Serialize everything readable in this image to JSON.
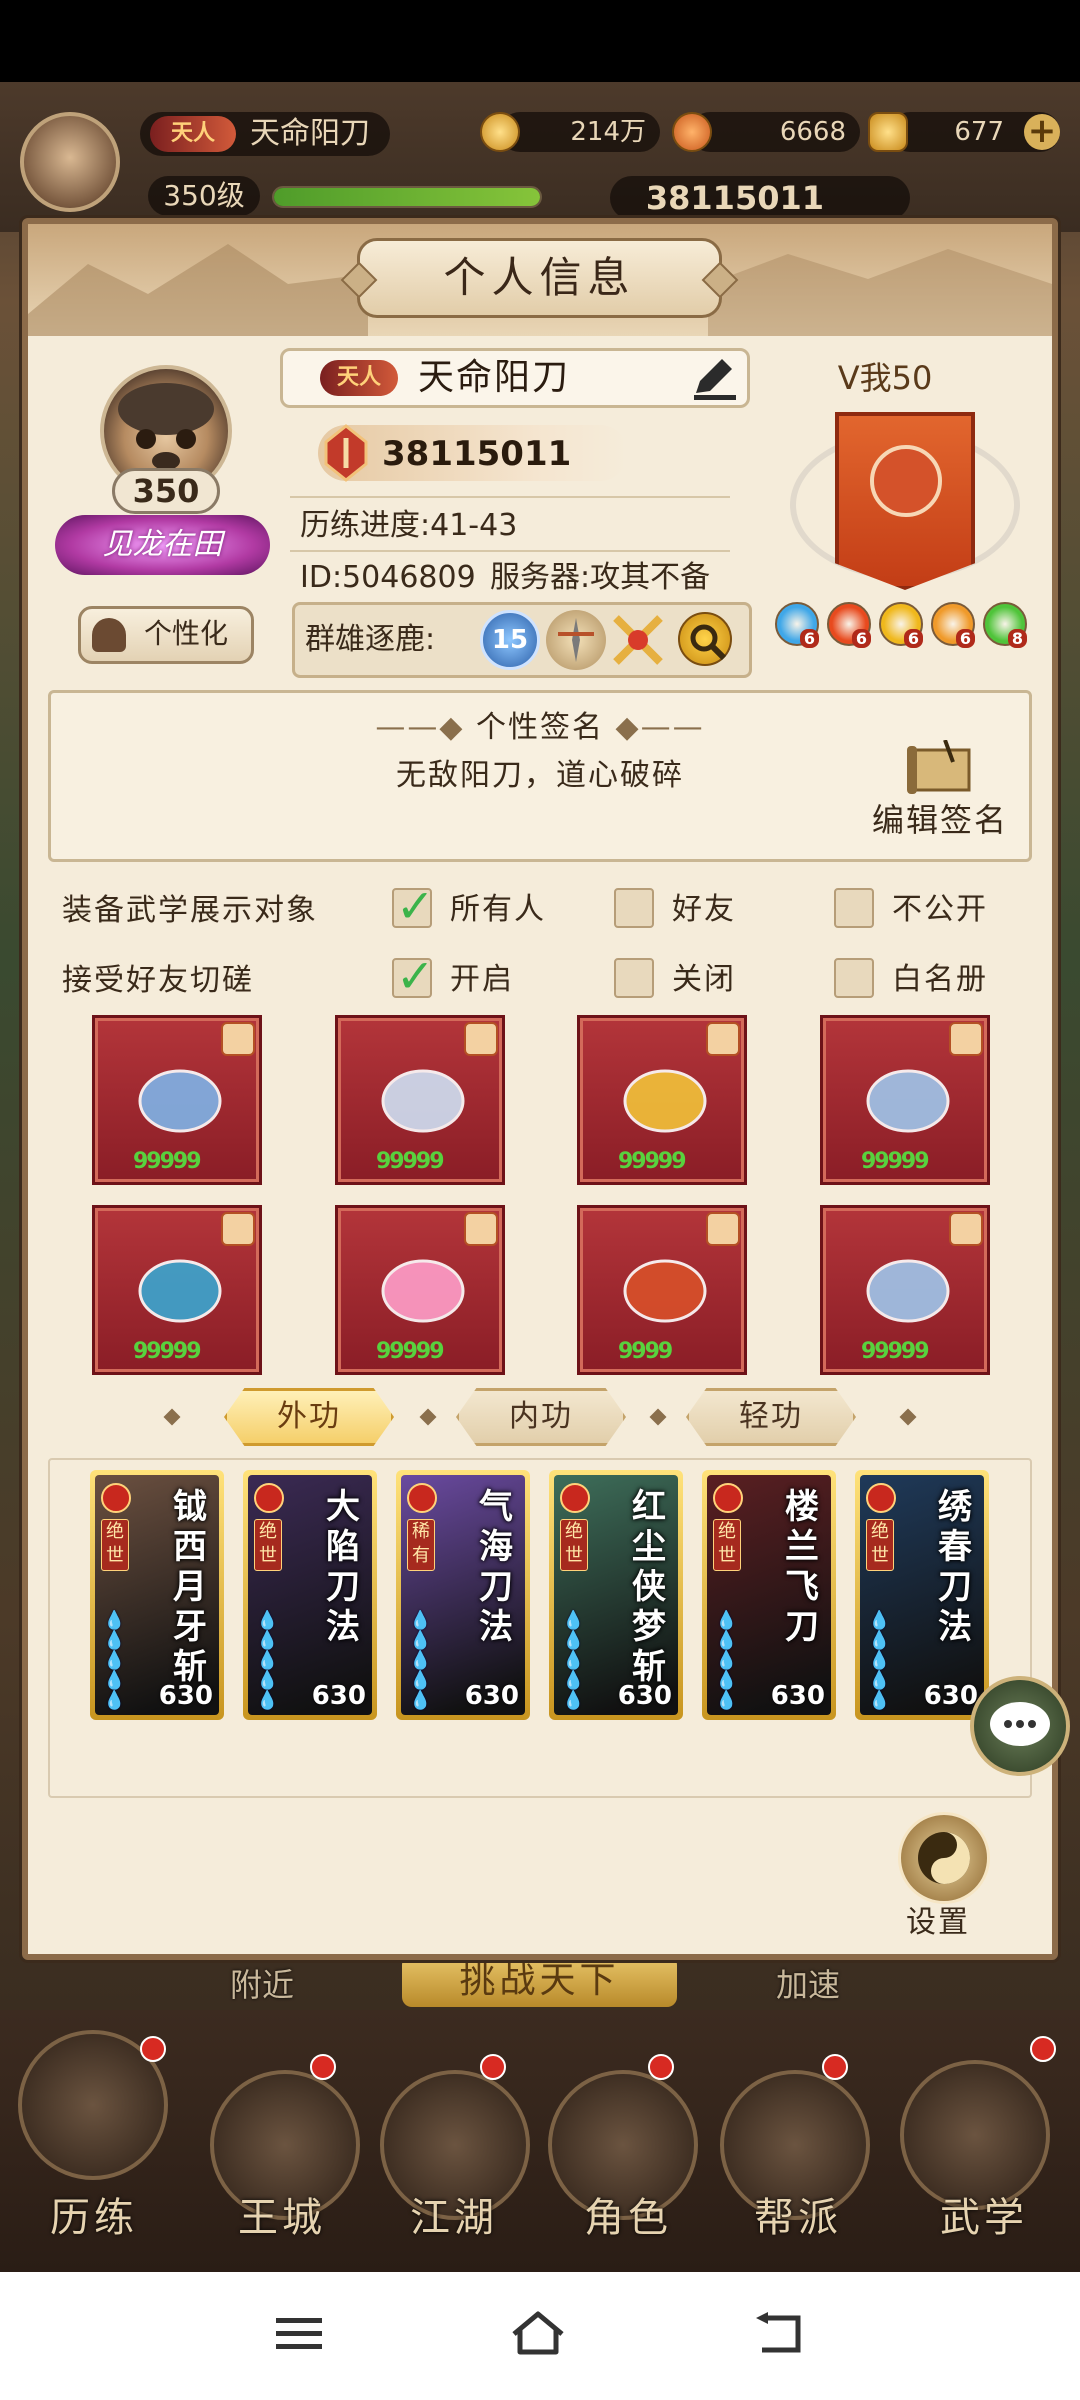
{
  "header": {
    "rank": "天人",
    "player_name": "天命阳刀",
    "level": "350级",
    "silver": "214万",
    "gold": "6668",
    "ingot": "677",
    "power": "38115011"
  },
  "modal": {
    "title": "个人信息",
    "avatar_level": "350",
    "title_badge": "见龙在田",
    "customize_button": "个性化",
    "rank_tag": "天人",
    "name": "天命阳刀",
    "power": "38115011",
    "progress": "历练进度:41-43",
    "id": "ID:5046809",
    "server": "服务器:攻其不备",
    "vip": "V我50",
    "group_label": "群雄逐鹿:",
    "group_icons": [
      "rank-15-icon",
      "tournament-icon",
      "swords-icon",
      "search-icon"
    ],
    "group_level": "15",
    "orbs": [
      {
        "color": "#3fa7e8",
        "num": "6"
      },
      {
        "color": "#e84a1e",
        "num": "6"
      },
      {
        "color": "#f0b81c",
        "num": "6"
      },
      {
        "color": "#f09a2a",
        "num": "6"
      },
      {
        "color": "#4fc43a",
        "num": "8"
      }
    ],
    "signature_title": "个性签名",
    "signature_text": "无敌阳刀，道心破碎",
    "edit_signature": "编辑签名",
    "settings_rows": [
      {
        "label": "装备武学展示对象",
        "options": [
          {
            "text": "所有人",
            "checked": true
          },
          {
            "text": "好友",
            "checked": false
          },
          {
            "text": "不公开",
            "checked": false
          }
        ]
      },
      {
        "label": "接受好友切磋",
        "options": [
          {
            "text": "开启",
            "checked": true
          },
          {
            "text": "关闭",
            "checked": false
          },
          {
            "text": "白名册",
            "checked": false
          }
        ]
      }
    ],
    "equipment": [
      {
        "name": "sword-icon",
        "stars": "99999"
      },
      {
        "name": "robe-icon",
        "stars": "99999"
      },
      {
        "name": "belt-icon",
        "stars": "99999"
      },
      {
        "name": "boots-icon",
        "stars": "99999"
      },
      {
        "name": "necklace-icon",
        "stars": "99999"
      },
      {
        "name": "pendant-icon",
        "stars": "99999"
      },
      {
        "name": "bracelet-icon",
        "stars": "9999"
      },
      {
        "name": "ring-icon",
        "stars": "99999"
      }
    ],
    "tabs": [
      "外功",
      "内功",
      "轻功"
    ],
    "skills": [
      {
        "name": "钺西月牙斩",
        "rarity": "绝世",
        "level": "630",
        "bg": "#6b5040"
      },
      {
        "name": "大陷刀法",
        "rarity": "绝世",
        "level": "630",
        "bg": "#3b2a54"
      },
      {
        "name": "气海刀法",
        "rarity": "稀有",
        "level": "630",
        "bg": "#6a4aa0"
      },
      {
        "name": "红尘侠梦斩",
        "rarity": "绝世",
        "level": "630",
        "bg": "#3e6e5a"
      },
      {
        "name": "楼兰飞刀",
        "rarity": "绝世",
        "level": "630",
        "bg": "#5a1f22"
      },
      {
        "name": "绣春刀法",
        "rarity": "绝世",
        "level": "630",
        "bg": "#1f3a5a"
      }
    ],
    "settings_label": "设置"
  },
  "behind": {
    "nearby": "附近",
    "challenge": "挑战天下",
    "speed": "加速"
  },
  "bottom_nav": [
    "历练",
    "王城",
    "江湖",
    "角色",
    "帮派",
    "武学"
  ]
}
